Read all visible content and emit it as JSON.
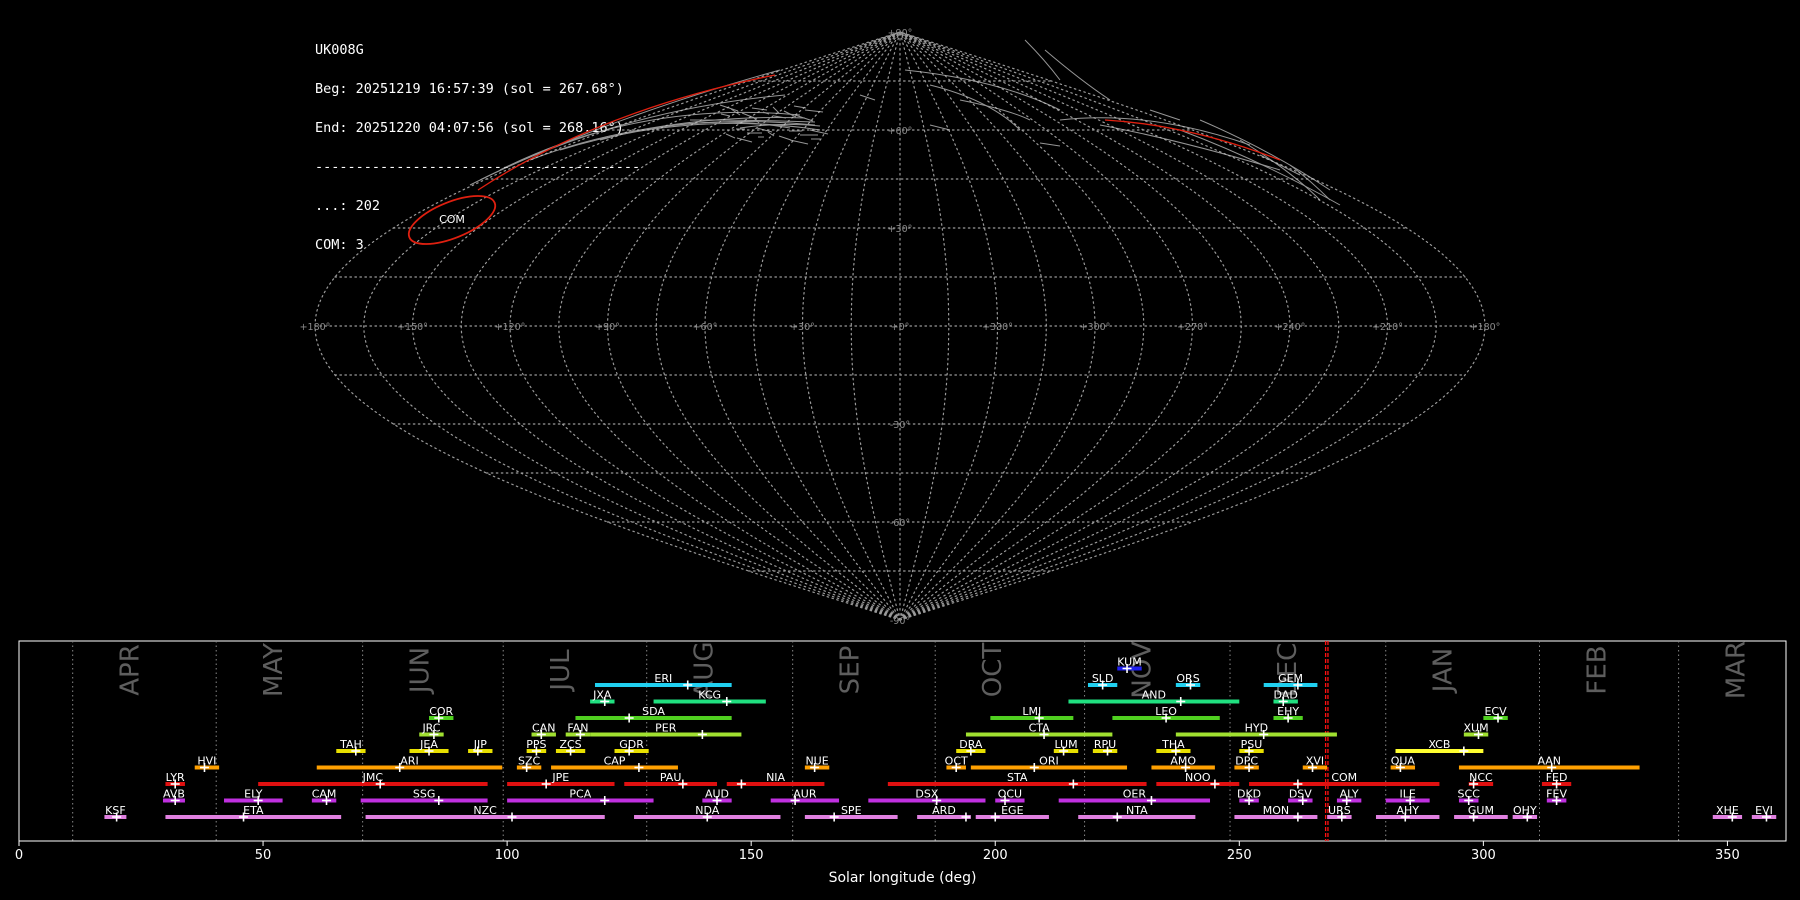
{
  "info": {
    "station": "UK008G",
    "begin": "Beg: 20251219 16:57:39 (sol = 267.68°)",
    "end": "End: 20251220 04:07:56 (sol = 268.16°)",
    "separator": "----------------------------------------",
    "sporadic_count": "...: 202",
    "shower_count": "COM: 3"
  },
  "map": {
    "lon_labels": [
      "+180°",
      "+150°",
      "+120°",
      "+90°",
      "+60°",
      "+30°",
      "+0°",
      "+330°",
      "+300°",
      "+270°",
      "+240°",
      "+210°",
      "+180°"
    ],
    "lat_labels": [
      "+90°",
      "+60°",
      "+30°",
      "-30°",
      "-60°",
      "-90°"
    ],
    "radiant_label": "COM",
    "colors": {
      "grid": "#9a9a9a",
      "radiant": "#e02010",
      "sporadic": "#c8c8c8"
    }
  },
  "chart_data": {
    "type": "timeline",
    "xlabel": "Solar longitude (deg)",
    "xlim": [
      0,
      362
    ],
    "x_ticks": [
      0,
      50,
      100,
      150,
      200,
      250,
      300,
      350
    ],
    "current_sol": [
      267.68,
      268.16
    ],
    "months": [
      {
        "name": "APR",
        "start": 11.0
      },
      {
        "name": "MAY",
        "start": 40.4
      },
      {
        "name": "JUN",
        "start": 70.4
      },
      {
        "name": "JUL",
        "start": 99.2
      },
      {
        "name": "AUG",
        "start": 128.6
      },
      {
        "name": "SEP",
        "start": 158.5
      },
      {
        "name": "OCT",
        "start": 187.7
      },
      {
        "name": "NOV",
        "start": 218.3
      },
      {
        "name": "DEC",
        "start": 248.1
      },
      {
        "name": "JAN",
        "start": 280.0
      },
      {
        "name": "FEB",
        "start": 311.5
      },
      {
        "name": "MAR",
        "start": 340.0
      }
    ],
    "showers": [
      {
        "code": "KSF",
        "start": 17.5,
        "end": 22.0,
        "peak": 20.0,
        "row": 0,
        "color": "#e080e0"
      },
      {
        "code": "ETA",
        "start": 30.0,
        "end": 66.0,
        "peak": 46.0,
        "row": 0,
        "color": "#e080e0"
      },
      {
        "code": "NZC",
        "start": 71.0,
        "end": 120.0,
        "peak": 101.0,
        "row": 0,
        "color": "#e080e0"
      },
      {
        "code": "NDA",
        "start": 126.0,
        "end": 156.0,
        "peak": 141.0,
        "row": 0,
        "color": "#e080e0"
      },
      {
        "code": "SPE",
        "start": 161.0,
        "end": 180.0,
        "peak": 167.0,
        "row": 0,
        "color": "#e080e0"
      },
      {
        "code": "ARD",
        "start": 184.0,
        "end": 195.0,
        "peak": 194.0,
        "row": 0,
        "color": "#e080e0"
      },
      {
        "code": "EGE",
        "start": 196.0,
        "end": 211.0,
        "peak": 200.0,
        "row": 0,
        "color": "#e080e0"
      },
      {
        "code": "NTA",
        "start": 217.0,
        "end": 241.0,
        "peak": 225.0,
        "row": 0,
        "color": "#e080e0"
      },
      {
        "code": "MON",
        "start": 249.0,
        "end": 266.0,
        "peak": 262.0,
        "row": 0,
        "color": "#e080e0"
      },
      {
        "code": "URS",
        "start": 268.0,
        "end": 273.0,
        "peak": 271.0,
        "row": 0,
        "color": "#e080e0"
      },
      {
        "code": "AHY",
        "start": 278.0,
        "end": 291.0,
        "peak": 284.0,
        "row": 0,
        "color": "#e080e0"
      },
      {
        "code": "GUM",
        "start": 294.0,
        "end": 305.0,
        "peak": 298.0,
        "row": 0,
        "color": "#e080e0"
      },
      {
        "code": "OHY",
        "start": 306.0,
        "end": 311.0,
        "peak": 309.0,
        "row": 0,
        "color": "#e080e0"
      },
      {
        "code": "XHE",
        "start": 347.0,
        "end": 353.0,
        "peak": 351.0,
        "row": 0,
        "color": "#e080e0"
      },
      {
        "code": "EVI",
        "start": 355.0,
        "end": 360.0,
        "peak": 358.0,
        "row": 0,
        "color": "#e080e0"
      },
      {
        "code": "AVB",
        "start": 29.5,
        "end": 34.0,
        "peak": 32.0,
        "row": 1,
        "color": "#c030e0"
      },
      {
        "code": "ELY",
        "start": 42.0,
        "end": 54.0,
        "peak": 49.0,
        "row": 1,
        "color": "#c030e0"
      },
      {
        "code": "CAM",
        "start": 60.0,
        "end": 65.0,
        "peak": 63.0,
        "row": 1,
        "color": "#c030e0"
      },
      {
        "code": "SSG",
        "start": 70.0,
        "end": 96.0,
        "peak": 86.0,
        "row": 1,
        "color": "#c030e0"
      },
      {
        "code": "PCA",
        "start": 100.0,
        "end": 130.0,
        "peak": 120.0,
        "row": 1,
        "color": "#c030e0"
      },
      {
        "code": "AUD",
        "start": 140.0,
        "end": 146.0,
        "peak": 143.0,
        "row": 1,
        "color": "#c030e0"
      },
      {
        "code": "AUR",
        "start": 154.0,
        "end": 168.0,
        "peak": 159.0,
        "row": 1,
        "color": "#c030e0"
      },
      {
        "code": "DSX",
        "start": 174.0,
        "end": 198.0,
        "peak": 188.0,
        "row": 1,
        "color": "#c030e0"
      },
      {
        "code": "OCU",
        "start": 200.0,
        "end": 206.0,
        "peak": 202.0,
        "row": 1,
        "color": "#c030e0"
      },
      {
        "code": "OER",
        "start": 213.0,
        "end": 244.0,
        "peak": 232.0,
        "row": 1,
        "color": "#c030e0"
      },
      {
        "code": "DKD",
        "start": 250.0,
        "end": 254.0,
        "peak": 252.0,
        "row": 1,
        "color": "#c030e0"
      },
      {
        "code": "DSV",
        "start": 260.0,
        "end": 265.0,
        "peak": 263.0,
        "row": 1,
        "color": "#c030e0"
      },
      {
        "code": "ALY",
        "start": 270.0,
        "end": 275.0,
        "peak": 272.0,
        "row": 1,
        "color": "#c030e0"
      },
      {
        "code": "ILE",
        "start": 280.0,
        "end": 289.0,
        "peak": 285.0,
        "row": 1,
        "color": "#c030e0"
      },
      {
        "code": "SCC",
        "start": 295.0,
        "end": 299.0,
        "peak": 297.0,
        "row": 1,
        "color": "#c030e0"
      },
      {
        "code": "FEV",
        "start": 313.0,
        "end": 317.0,
        "peak": 315.0,
        "row": 1,
        "color": "#c030e0"
      },
      {
        "code": "LYR",
        "start": 30.0,
        "end": 34.0,
        "peak": 32.0,
        "row": 2,
        "color": "#e01010"
      },
      {
        "code": "JMC",
        "start": 49.0,
        "end": 96.0,
        "peak": 74.0,
        "row": 2,
        "color": "#e01010"
      },
      {
        "code": "JPE",
        "start": 100.0,
        "end": 122.0,
        "peak": 108.0,
        "row": 2,
        "color": "#e01010"
      },
      {
        "code": "PAU",
        "start": 124.0,
        "end": 143.0,
        "peak": 136.0,
        "row": 2,
        "color": "#e01010"
      },
      {
        "code": "NIA",
        "start": 145.0,
        "end": 165.0,
        "peak": 148.0,
        "row": 2,
        "color": "#e01010"
      },
      {
        "code": "STA",
        "start": 178.0,
        "end": 231.0,
        "peak": 216.0,
        "row": 2,
        "color": "#e01010"
      },
      {
        "code": "NOO",
        "start": 233.0,
        "end": 250.0,
        "peak": 245.0,
        "row": 2,
        "color": "#e01010"
      },
      {
        "code": "COM",
        "start": 252.0,
        "end": 291.0,
        "peak": 262.0,
        "row": 2,
        "color": "#e01010"
      },
      {
        "code": "NCC",
        "start": 297.0,
        "end": 302.0,
        "peak": 298.0,
        "row": 2,
        "color": "#e01010"
      },
      {
        "code": "FED",
        "start": 312.0,
        "end": 318.0,
        "peak": 315.0,
        "row": 2,
        "color": "#e01010"
      },
      {
        "code": "HVI",
        "start": 36.0,
        "end": 41.0,
        "peak": 38.0,
        "row": 3,
        "color": "#ffa000"
      },
      {
        "code": "ARI",
        "start": 61.0,
        "end": 99.0,
        "peak": 78.0,
        "row": 3,
        "color": "#ffa000"
      },
      {
        "code": "SZC",
        "start": 102.0,
        "end": 107.0,
        "peak": 104.0,
        "row": 3,
        "color": "#ffa000"
      },
      {
        "code": "CAP",
        "start": 109.0,
        "end": 135.0,
        "peak": 127.0,
        "row": 3,
        "color": "#ffa000"
      },
      {
        "code": "NUE",
        "start": 161.0,
        "end": 166.0,
        "peak": 163.0,
        "row": 3,
        "color": "#ffa000"
      },
      {
        "code": "OCT",
        "start": 190.0,
        "end": 194.0,
        "peak": 192.0,
        "row": 3,
        "color": "#ffa000"
      },
      {
        "code": "ORI",
        "start": 195.0,
        "end": 227.0,
        "peak": 208.0,
        "row": 3,
        "color": "#ffa000"
      },
      {
        "code": "AMO",
        "start": 232.0,
        "end": 245.0,
        "peak": 239.0,
        "row": 3,
        "color": "#ffa000"
      },
      {
        "code": "DPC",
        "start": 249.0,
        "end": 254.0,
        "peak": 252.0,
        "row": 3,
        "color": "#ffa000"
      },
      {
        "code": "XVI",
        "start": 263.0,
        "end": 268.0,
        "peak": 265.0,
        "row": 3,
        "color": "#ffa000"
      },
      {
        "code": "QUA",
        "start": 281.0,
        "end": 286.0,
        "peak": 283.0,
        "row": 3,
        "color": "#ffa000"
      },
      {
        "code": "AAN",
        "start": 295.0,
        "end": 332.0,
        "peak": 314.0,
        "row": 3,
        "color": "#ffa000"
      },
      {
        "code": "TAH",
        "start": 65.0,
        "end": 71.0,
        "peak": 69.0,
        "row": 4,
        "color": "#e8e000"
      },
      {
        "code": "JEA",
        "start": 80.0,
        "end": 88.0,
        "peak": 84.0,
        "row": 4,
        "color": "#e8e000"
      },
      {
        "code": "JIP",
        "start": 92.0,
        "end": 97.0,
        "peak": 94.0,
        "row": 4,
        "color": "#e8e000"
      },
      {
        "code": "PPS",
        "start": 104.0,
        "end": 108.0,
        "peak": 106.0,
        "row": 4,
        "color": "#e8e000"
      },
      {
        "code": "ZCS",
        "start": 110.0,
        "end": 116.0,
        "peak": 113.0,
        "row": 4,
        "color": "#e8e000"
      },
      {
        "code": "GDR",
        "start": 122.0,
        "end": 129.0,
        "peak": 125.0,
        "row": 4,
        "color": "#e8e000"
      },
      {
        "code": "DRA",
        "start": 192.0,
        "end": 198.0,
        "peak": 195.0,
        "row": 4,
        "color": "#e8e000"
      },
      {
        "code": "LUM",
        "start": 212.0,
        "end": 217.0,
        "peak": 214.0,
        "row": 4,
        "color": "#e8e000"
      },
      {
        "code": "RPU",
        "start": 220.0,
        "end": 225.0,
        "peak": 223.0,
        "row": 4,
        "color": "#e8e000"
      },
      {
        "code": "THA",
        "start": 233.0,
        "end": 240.0,
        "peak": 237.0,
        "row": 4,
        "color": "#e8e000"
      },
      {
        "code": "PSU",
        "start": 250.0,
        "end": 255.0,
        "peak": 252.0,
        "row": 4,
        "color": "#e8e000"
      },
      {
        "code": "XCB",
        "start": 282.0,
        "end": 300.0,
        "peak": 296.0,
        "row": 4,
        "color": "#ffff30"
      },
      {
        "code": "JRC",
        "start": 82.0,
        "end": 87.0,
        "peak": 85.0,
        "row": 5,
        "color": "#a0e030"
      },
      {
        "code": "CAN",
        "start": 105.0,
        "end": 110.0,
        "peak": 107.0,
        "row": 5,
        "color": "#a0e030"
      },
      {
        "code": "FAN",
        "start": 112.0,
        "end": 117.0,
        "peak": 115.0,
        "row": 5,
        "color": "#a0e030"
      },
      {
        "code": "PER",
        "start": 117.0,
        "end": 148.0,
        "peak": 140.0,
        "row": 5,
        "color": "#a0e030"
      },
      {
        "code": "CTA",
        "start": 194.0,
        "end": 224.0,
        "peak": 210.0,
        "row": 5,
        "color": "#a0e030"
      },
      {
        "code": "HYD",
        "start": 237.0,
        "end": 270.0,
        "peak": 255.0,
        "row": 5,
        "color": "#a0e030"
      },
      {
        "code": "XUM",
        "start": 296.0,
        "end": 301.0,
        "peak": 299.0,
        "row": 5,
        "color": "#a0e030"
      },
      {
        "code": "COR",
        "start": 84.0,
        "end": 89.0,
        "peak": 86.0,
        "row": 6,
        "color": "#50d020"
      },
      {
        "code": "SDA",
        "start": 114.0,
        "end": 146.0,
        "peak": 125.0,
        "row": 6,
        "color": "#50d020"
      },
      {
        "code": "LMI",
        "start": 199.0,
        "end": 216.0,
        "peak": 209.0,
        "row": 6,
        "color": "#50d020"
      },
      {
        "code": "LEO",
        "start": 224.0,
        "end": 246.0,
        "peak": 235.0,
        "row": 6,
        "color": "#50d020"
      },
      {
        "code": "EHY",
        "start": 257.0,
        "end": 263.0,
        "peak": 260.0,
        "row": 6,
        "color": "#50d020"
      },
      {
        "code": "ECV",
        "start": 300.0,
        "end": 305.0,
        "peak": 303.0,
        "row": 6,
        "color": "#50d020"
      },
      {
        "code": "JXA",
        "start": 117.0,
        "end": 122.0,
        "peak": 120.0,
        "row": 7,
        "color": "#20e080"
      },
      {
        "code": "KCG",
        "start": 130.0,
        "end": 153.0,
        "peak": 145.0,
        "row": 7,
        "color": "#20e080"
      },
      {
        "code": "AND",
        "start": 215.0,
        "end": 250.0,
        "peak": 238.0,
        "row": 7,
        "color": "#20e080"
      },
      {
        "code": "DAD",
        "start": 257.0,
        "end": 262.0,
        "peak": 259.0,
        "row": 7,
        "color": "#20e080"
      },
      {
        "code": "ERI",
        "start": 118.0,
        "end": 146.0,
        "peak": 137.0,
        "row": 8,
        "color": "#20d0f0"
      },
      {
        "code": "SLD",
        "start": 219.0,
        "end": 225.0,
        "peak": 222.0,
        "row": 8,
        "color": "#20d0f0"
      },
      {
        "code": "ORS",
        "start": 237.0,
        "end": 242.0,
        "peak": 240.0,
        "row": 8,
        "color": "#20d0f0"
      },
      {
        "code": "GEM",
        "start": 255.0,
        "end": 266.0,
        "peak": 262.0,
        "row": 8,
        "color": "#20d0f0"
      },
      {
        "code": "KUM",
        "start": 225.0,
        "end": 230.0,
        "peak": 227.0,
        "row": 9,
        "color": "#2020f0"
      }
    ]
  }
}
